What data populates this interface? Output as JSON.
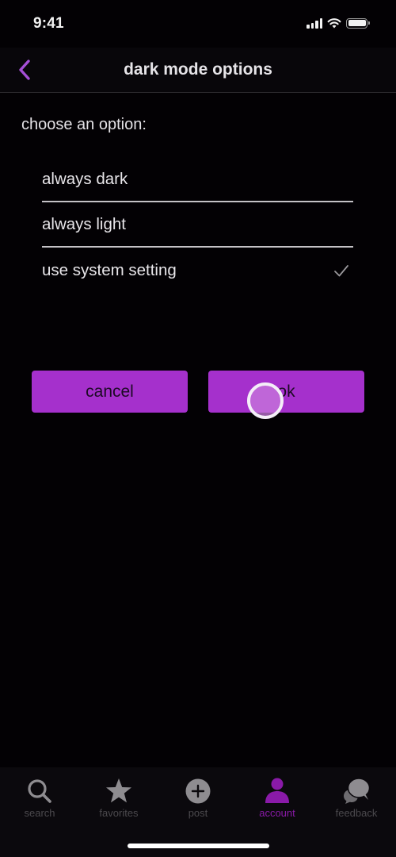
{
  "status_bar": {
    "time": "9:41",
    "icons": [
      "cellular-signal-icon",
      "wifi-icon",
      "battery-icon"
    ]
  },
  "nav": {
    "title": "dark mode options",
    "back_icon": "chevron-left-icon"
  },
  "content": {
    "prompt": "choose an option:",
    "options": [
      {
        "label": "always dark",
        "selected": false
      },
      {
        "label": "always light",
        "selected": false
      },
      {
        "label": "use system setting",
        "selected": true
      }
    ],
    "cancel_label": "cancel",
    "ok_label": "ok"
  },
  "tab_bar": {
    "items": [
      {
        "label": "search",
        "icon": "search-icon",
        "active": false
      },
      {
        "label": "favorites",
        "icon": "star-icon",
        "active": false
      },
      {
        "label": "post",
        "icon": "plus-circle-icon",
        "active": false
      },
      {
        "label": "account",
        "icon": "person-icon",
        "active": true
      },
      {
        "label": "feedback",
        "icon": "chat-bubbles-icon",
        "active": false
      }
    ]
  },
  "colors": {
    "accent": "#a530cc",
    "active_tab": "#8a1aa8",
    "inactive_tab": "#8e8c90",
    "background": "#030104"
  }
}
